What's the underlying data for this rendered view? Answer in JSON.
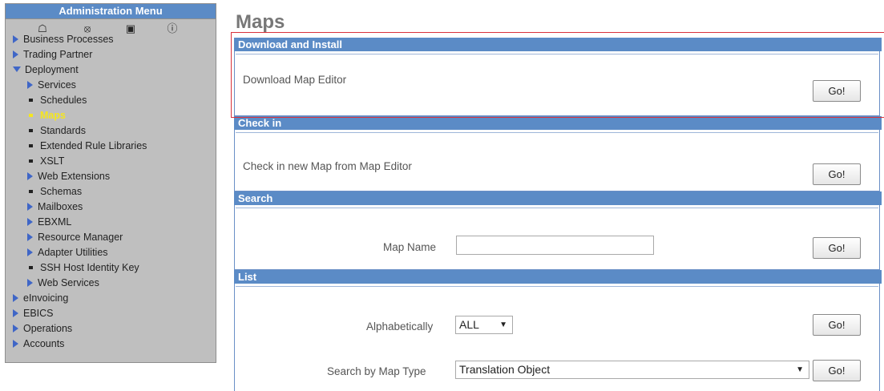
{
  "admin_menu": {
    "title": "Administration Menu",
    "icons": [
      "home-icon",
      "global-icon",
      "add-icon",
      "help-icon"
    ],
    "items": [
      {
        "label": "Business Processes"
      },
      {
        "label": "Trading Partner"
      },
      {
        "label": "Deployment"
      },
      {
        "label": "Services"
      },
      {
        "label": "Schedules"
      },
      {
        "label": "Maps"
      },
      {
        "label": "Standards"
      },
      {
        "label": "Extended Rule Libraries"
      },
      {
        "label": "XSLT"
      },
      {
        "label": "Web Extensions"
      },
      {
        "label": "Schemas"
      },
      {
        "label": "Mailboxes"
      },
      {
        "label": "EBXML"
      },
      {
        "label": "Resource Manager"
      },
      {
        "label": "Adapter Utilities"
      },
      {
        "label": "SSH Host Identity Key"
      },
      {
        "label": "Web Services"
      },
      {
        "label": "eInvoicing"
      },
      {
        "label": "EBICS"
      },
      {
        "label": "Operations"
      },
      {
        "label": "Accounts"
      }
    ],
    "active_item": "Maps",
    "colors": {
      "header": "#5b8bc6",
      "background": "#bfbfbf",
      "arrow": "#3f66c7",
      "active": "#f5e61e"
    }
  },
  "page": {
    "title": "Maps",
    "sections": {
      "download": {
        "heading": "Download and Install",
        "label": "Download Map Editor",
        "button": "Go!"
      },
      "checkin": {
        "heading": "Check in",
        "label": "Check in new Map from Map Editor",
        "button": "Go!"
      },
      "search": {
        "heading": "Search",
        "field_label": "Map Name",
        "field_value": "",
        "button": "Go!"
      },
      "list": {
        "heading": "List",
        "alpha_label": "Alphabetically",
        "alpha_value": "ALL",
        "alpha_button": "Go!",
        "type_label": "Search by Map Type",
        "type_value": "Translation Object",
        "type_button": "Go!"
      }
    }
  },
  "highlight": {
    "color": "#d8323c"
  }
}
